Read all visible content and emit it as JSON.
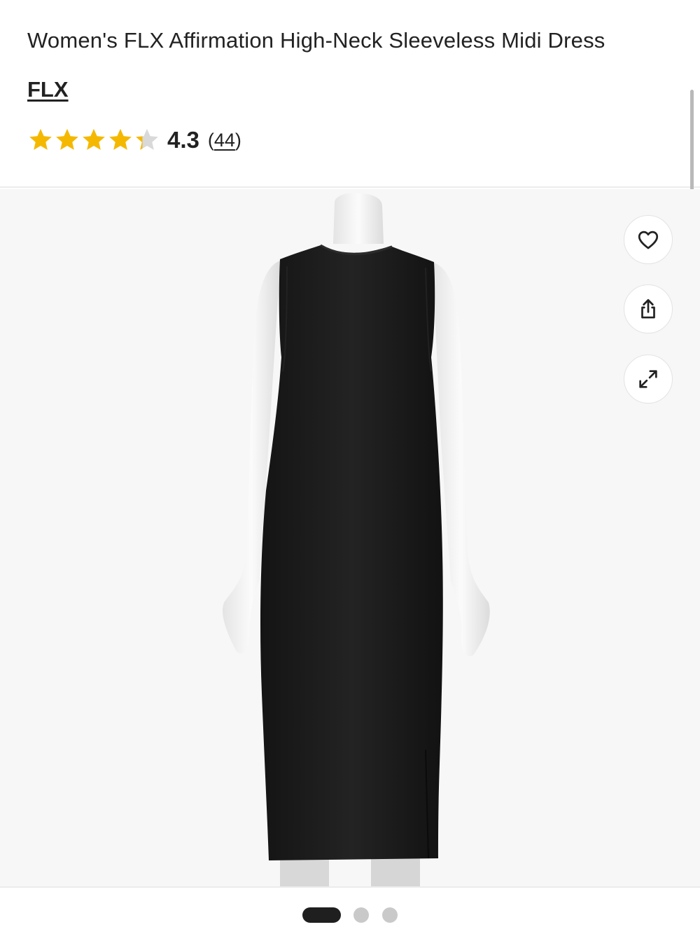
{
  "product": {
    "title": "Women's FLX Affirmation High-Neck Sleeveless Midi Dress",
    "brand": "FLX",
    "rating": {
      "value": 4.3,
      "value_text": "4.3",
      "count_open": "(",
      "count": "44",
      "count_close": ")",
      "max_stars": 5
    }
  },
  "image": {
    "subject": "black sleeveless high-neck midi dress on mannequin",
    "dress_color": "#1c1c1c"
  },
  "actions": {
    "favorite_icon": "heart-icon",
    "share_icon": "share-icon",
    "expand_icon": "expand-icon"
  },
  "carousel": {
    "total": 3,
    "active_index": 0
  },
  "colors": {
    "star_filled": "#f5b800",
    "star_empty": "#d9d9d9",
    "text": "#222222"
  }
}
